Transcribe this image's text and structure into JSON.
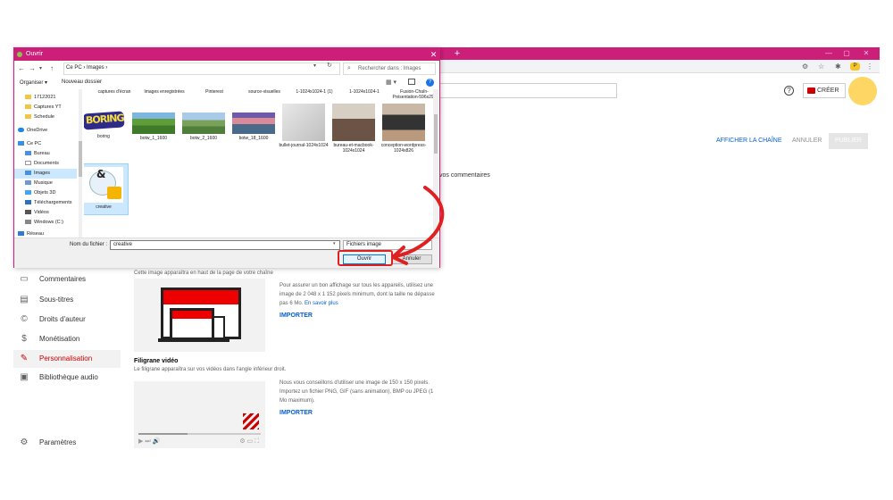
{
  "browser": {
    "new_tab_label": "+",
    "controls": [
      "—",
      "▢",
      "✕"
    ],
    "nav_icons": [
      "←",
      "→",
      "↻"
    ],
    "right_icons": [
      "⚙",
      "☆",
      "✱",
      "⋮"
    ],
    "extension_label": "P"
  },
  "studio": {
    "create_label": "CRÉER",
    "help_label": "?",
    "actions": {
      "view": "AFFICHER LA CHAÎNE",
      "cancel": "ANNULER",
      "publish": "PUBLIER"
    },
    "comments_fragment": "vos commentaires",
    "sidebar": [
      {
        "icon": "▭",
        "label": "Commentaires"
      },
      {
        "icon": "▤",
        "label": "Sous-titres"
      },
      {
        "icon": "©",
        "label": "Droits d'auteur"
      },
      {
        "icon": "$",
        "label": "Monétisation"
      },
      {
        "icon": "✎",
        "label": "Personnalisation",
        "active": true
      },
      {
        "icon": "▣",
        "label": "Bibliothèque audio"
      }
    ],
    "settings_label": "Paramètres",
    "banner": {
      "description": "Cette image apparaîtra en haut de la page de votre chaîne",
      "text": "Pour assurer un bon affichage sur tous les appareils, utilisez une image de 2 048 x 1 152 pixels minimum, dont la taille ne dépasse pas 6 Mo.",
      "link": "En savoir plus",
      "import_label": "IMPORTER"
    },
    "watermark": {
      "title": "Filigrane vidéo",
      "description": "Le filigrane apparaîtra sur vos vidéos dans l'angle inférieur droit.",
      "text": "Nous vous conseillons d'utiliser une image de 150 x 150 pixels. Importez un fichier PNG, GIF (sans animation), BMP ou JPEG (1 Mo maximum).",
      "import_label": "IMPORTER",
      "controls": "▶  ⏭  🔊",
      "controls_right": "⚙  ▭  ⛶"
    }
  },
  "dialog": {
    "title": "Ouvrir",
    "close_label": "✕",
    "breadcrumb": "Ce PC  ›  Images  ›",
    "search_placeholder": "Rechercher dans : Images",
    "organize_label": "Organiser ▾",
    "new_folder_label": "Nouveau dossier",
    "nav_items": [
      {
        "icon": "folder",
        "label": "17122021"
      },
      {
        "icon": "folder",
        "label": "Captures YT"
      },
      {
        "icon": "folder",
        "label": "Schedule"
      },
      {
        "icon": "cloud",
        "label": "OneDrive"
      },
      {
        "icon": "pc",
        "label": "Ce PC"
      },
      {
        "icon": "blue",
        "label": "Bureau"
      },
      {
        "icon": "doc",
        "label": "Documents"
      },
      {
        "icon": "blue",
        "label": "Images",
        "selected": true
      },
      {
        "icon": "music",
        "label": "Musique"
      },
      {
        "icon": "cube",
        "label": "Objets 3D"
      },
      {
        "icon": "dl",
        "label": "Téléchargements"
      },
      {
        "icon": "video",
        "label": "Vidéos"
      },
      {
        "icon": "drive",
        "label": "Windows (C:)"
      },
      {
        "icon": "net",
        "label": "Réseau"
      }
    ],
    "top_row": [
      {
        "label": "captures d'écran"
      },
      {
        "label": "Images enregistrées"
      },
      {
        "label": "Pinterest"
      },
      {
        "label": "source-visuelles"
      },
      {
        "label": "1-1024x1024-1 (1)"
      },
      {
        "label": "1-1024x1024-1"
      },
      {
        "label": "Fusion-Chaîn-Présentation-596x292"
      }
    ],
    "thumbnails": [
      {
        "label": "boring",
        "kind": "boring"
      },
      {
        "label": "botw_1_1600",
        "kind": "green"
      },
      {
        "label": "botw_2_1600",
        "kind": "hills"
      },
      {
        "label": "botw_18_1600",
        "kind": "sunset"
      },
      {
        "label": "bullet-journal-1024x1024",
        "kind": "journal"
      },
      {
        "label": "bureau-et-macbook-1024x1024",
        "kind": "desk"
      },
      {
        "label": "conception-wordpress-1024x826",
        "kind": "laptop"
      }
    ],
    "selected_file": {
      "label": "creative"
    },
    "filename_label": "Nom du fichier :",
    "filename_value": "creative",
    "filetype_label": "Fichiers image",
    "open_label": "Ouvrir",
    "cancel_label": "Annuler"
  },
  "colors": {
    "brand_pink": "#cc1f7a",
    "youtube_red": "#cc0000",
    "link_blue": "#065fd4",
    "avatar_yellow": "#fdd663",
    "highlight_red": "#e02020"
  }
}
